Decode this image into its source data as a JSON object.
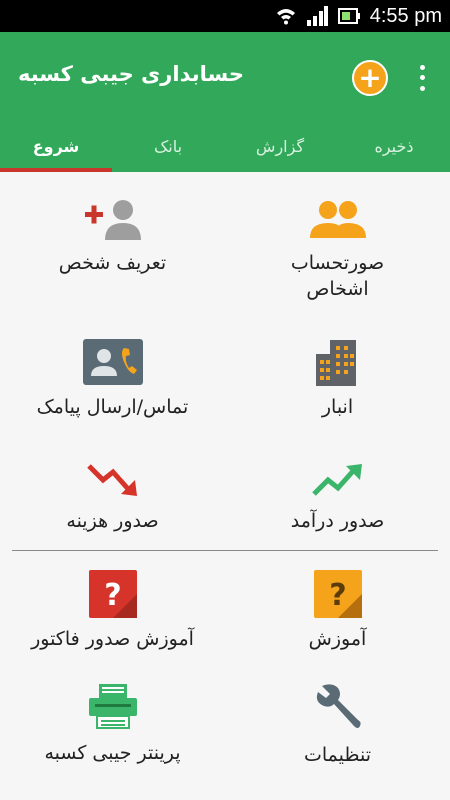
{
  "status": {
    "time": "4:55 pm"
  },
  "app": {
    "title": "حسابداری جیبی کسبه"
  },
  "tabs": [
    {
      "label": "شروع"
    },
    {
      "label": "بانک"
    },
    {
      "label": "گزارش"
    },
    {
      "label": "ذخیره"
    }
  ],
  "menu": {
    "add_person": "تعریف شخص",
    "accounts": "صورتحساب اشخاص",
    "contact": "تماس/ارسال پیامک",
    "warehouse": "انبار",
    "expense": "صدور هزینه",
    "income": "صدور درآمد",
    "invoice_tutorial": "آموزش صدور فاکتور",
    "tutorial": "آموزش",
    "printer": "پرینتر جیبی کسبه",
    "settings": "تنظیمات"
  },
  "colors": {
    "primary": "#31a85a",
    "accent": "#f4a31b",
    "indicator": "#c9362b"
  }
}
